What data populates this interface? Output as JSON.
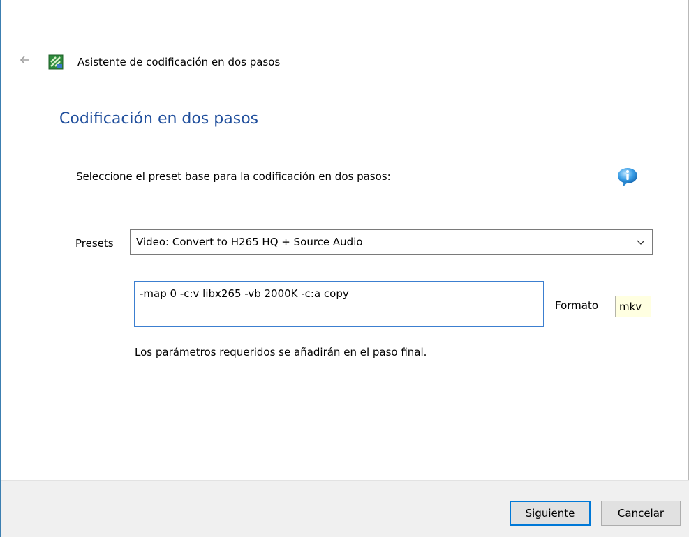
{
  "wizard": {
    "title": "Asistente de codificación en dos pasos",
    "back_icon": "back-arrow-icon",
    "app_icon": "ffmpeg-app-icon"
  },
  "page": {
    "heading": "Codificación en dos pasos",
    "instruction": "Seleccione el preset base para la codificación en dos pasos:",
    "info_icon": "info-icon"
  },
  "presets": {
    "label": "Presets",
    "selected": "Video: Convert to H265 HQ + Source Audio"
  },
  "parameters": {
    "value": "-map 0 -c:v libx265 -vb 2000K -c:a copy",
    "hint": "Los parámetros requeridos se añadirán en el paso final."
  },
  "formato": {
    "label": "Formato",
    "value": "mkv"
  },
  "buttons": {
    "next": "Siguiente",
    "cancel": "Cancelar"
  },
  "colors": {
    "heading": "#1f4e9c",
    "focus_border": "#0078d7",
    "footer_bg": "#f0f0f0",
    "formato_bg": "#ffffe1"
  }
}
